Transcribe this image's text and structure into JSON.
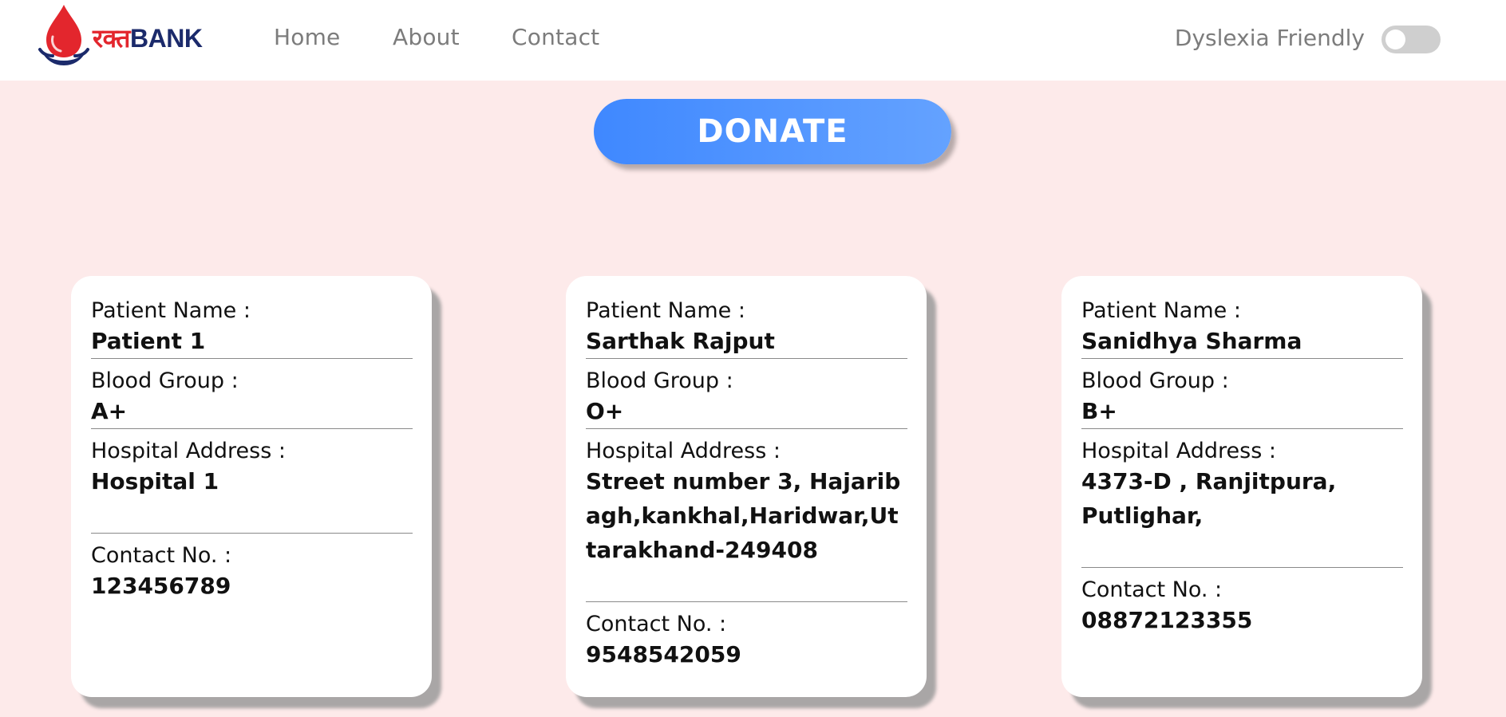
{
  "navbar": {
    "logo_hindi": "रक्त",
    "logo_bank": "BANK",
    "links": [
      "Home",
      "About",
      "Contact"
    ],
    "toggle_label": "Dyslexia Friendly",
    "toggle_on": false
  },
  "donate_label": "DONATE",
  "labels": {
    "patient_name": "Patient Name :",
    "blood_group": "Blood Group :",
    "hospital_address": "Hospital Address :",
    "contact": "Contact No. :"
  },
  "cards": [
    {
      "name": "Patient 1",
      "blood_group": "A+",
      "address": "Hospital 1",
      "contact": "123456789"
    },
    {
      "name": "Sarthak Rajput",
      "blood_group": "O+",
      "address": "Street number 3, Hajaribagh,kankhal,Haridwar,Uttarakhand-249408",
      "contact": "9548542059"
    },
    {
      "name": "Sanidhya Sharma",
      "blood_group": "B+",
      "address": "4373-D , Ranjitpura, Putlighar,",
      "contact": "08872123355"
    }
  ],
  "colors": {
    "background": "#fdeaea",
    "accent_blue": "#3f88ff",
    "logo_red": "#e3262d",
    "logo_navy": "#1b2a6b"
  }
}
